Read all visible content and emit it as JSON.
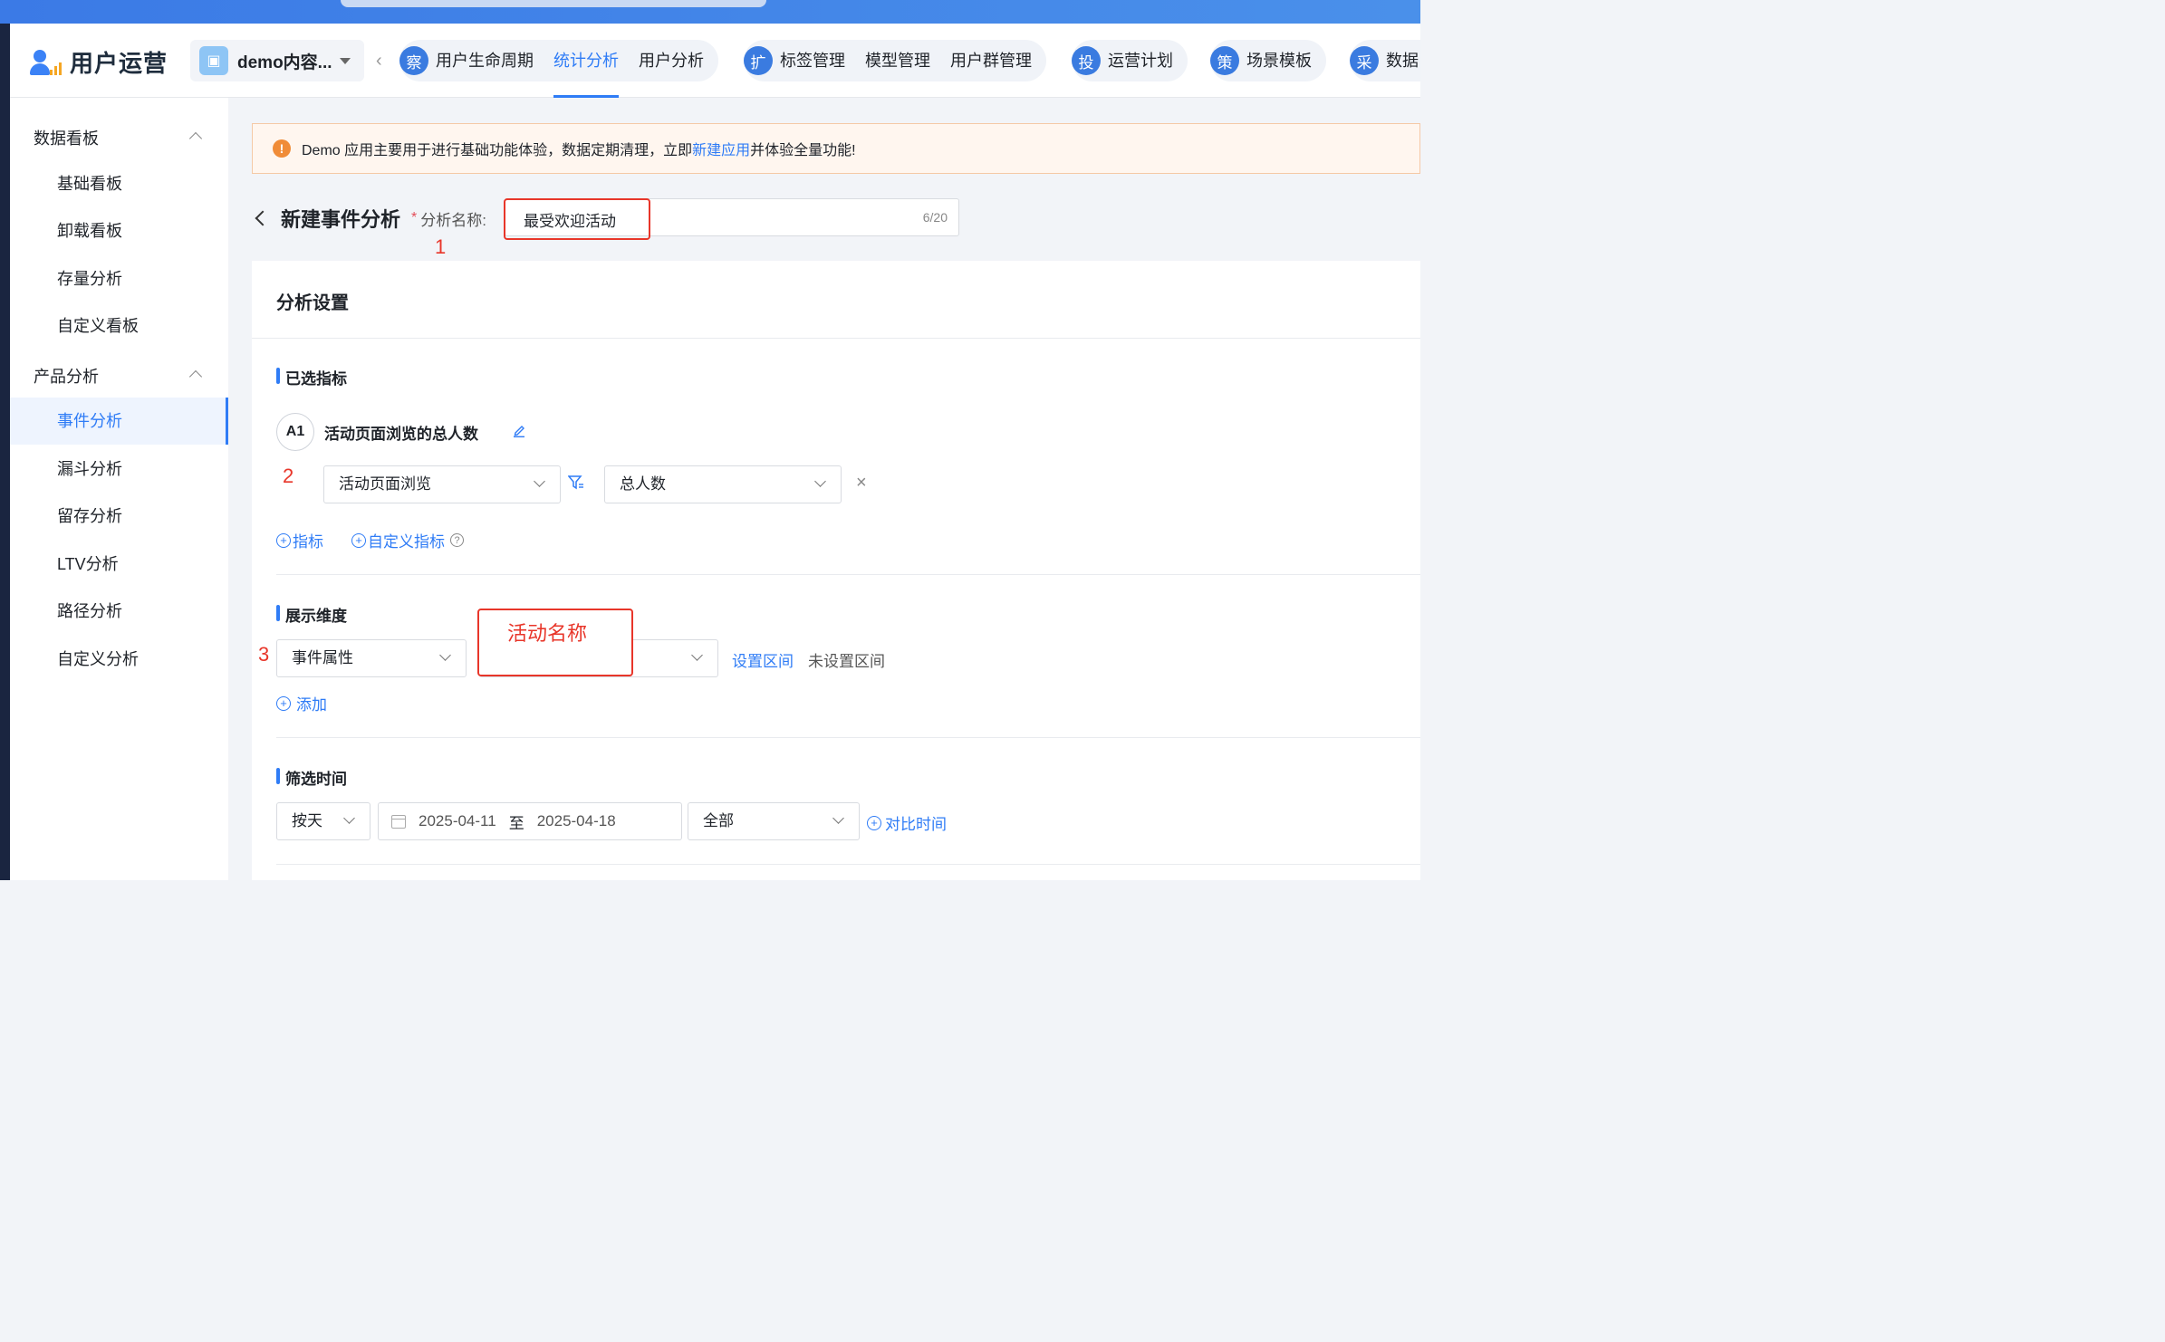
{
  "header": {
    "product_title": "用户运营",
    "app_selector": {
      "name": "demo内容..."
    },
    "nav_groups": [
      {
        "badge": "察",
        "items": [
          "用户生命周期",
          "统计分析",
          "用户分析"
        ],
        "active": "统计分析"
      },
      {
        "badge": "扩",
        "items": [
          "标签管理",
          "模型管理",
          "用户群管理"
        ]
      },
      {
        "badge": "投",
        "items": [
          "运营计划"
        ]
      },
      {
        "badge": "策",
        "items": [
          "场景模板"
        ]
      },
      {
        "badge": "采",
        "items": [
          "数据"
        ]
      }
    ]
  },
  "sidebar": {
    "groups": [
      {
        "label": "数据看板",
        "items": [
          "基础看板",
          "卸载看板",
          "存量分析",
          "自定义看板"
        ]
      },
      {
        "label": "产品分析",
        "items": [
          "事件分析",
          "漏斗分析",
          "留存分析",
          "LTV分析",
          "路径分析",
          "自定义分析"
        ]
      }
    ],
    "active_item": "事件分析"
  },
  "notice": {
    "icon": "warning-icon",
    "text_before": "Demo 应用主要用于进行基础功能体验，数据定期清理，立即",
    "link": "新建应用",
    "text_after": "并体验全量功能!"
  },
  "page": {
    "title": "新建事件分析",
    "required_mark": "*",
    "name_label": "分析名称:",
    "name_value": "最受欢迎活动",
    "name_count": "6/20"
  },
  "annotations": {
    "n1": "1",
    "n2": "2",
    "n3": "3",
    "label3": "活动名称"
  },
  "settings": {
    "title": "分析设置",
    "metrics": {
      "section_title": "已选指标",
      "badge": "A1",
      "metric_name": "活动页面浏览的总人数",
      "event_select": "活动页面浏览",
      "agg_select": "总人数",
      "add_metric": "指标",
      "add_custom_metric": "自定义指标",
      "help": "?"
    },
    "dimension": {
      "section_title": "展示维度",
      "type_select": "事件属性",
      "property_select": "",
      "set_range": "设置区间",
      "range_status": "未设置区间",
      "add": "添加"
    },
    "time": {
      "section_title": "筛选时间",
      "granularity": "按天",
      "start_date": "2025-04-11",
      "to": "至",
      "end_date": "2025-04-18",
      "scope": "全部",
      "compare": "对比时间"
    }
  },
  "colors": {
    "accent": "#2f7cf6",
    "annotation_red": "#e8362a",
    "warning": "#f08c38"
  }
}
